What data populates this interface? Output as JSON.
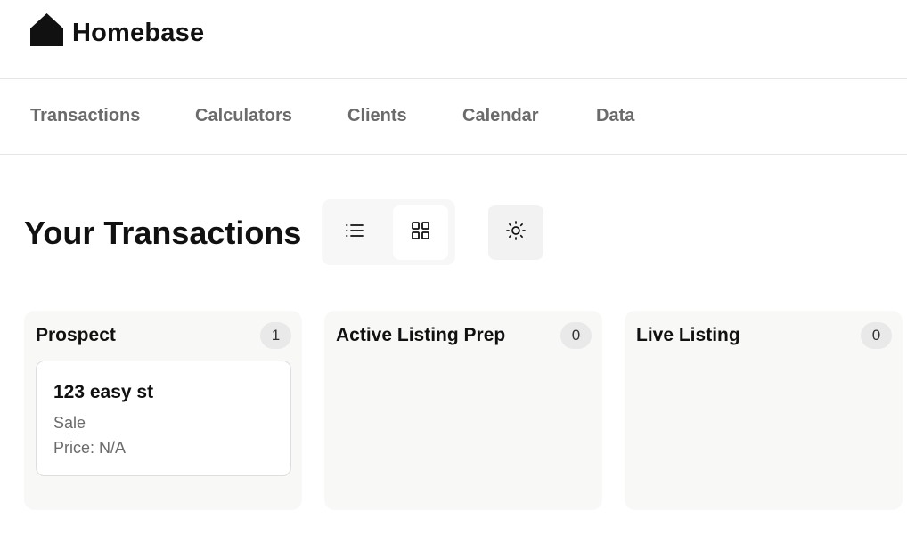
{
  "app": {
    "logo_text": "Homebase",
    "logo_icon": "house-icon"
  },
  "nav": {
    "items": [
      {
        "label": "Transactions"
      },
      {
        "label": "Calculators"
      },
      {
        "label": "Clients"
      },
      {
        "label": "Calendar"
      },
      {
        "label": "Data"
      }
    ]
  },
  "page": {
    "title": "Your Transactions",
    "view_toggle": {
      "list_icon": "list-icon",
      "grid_icon": "grid-icon",
      "selected": "grid"
    },
    "theme_icon": "sun-icon"
  },
  "columns": [
    {
      "title": "Prospect",
      "count": "1",
      "cards": [
        {
          "title": "123 easy st",
          "type": "Sale",
          "price": "Price: N/A"
        }
      ]
    },
    {
      "title": "Active Listing Prep",
      "count": "0",
      "cards": []
    },
    {
      "title": "Live Listing",
      "count": "0",
      "cards": []
    }
  ],
  "colors": {
    "text_primary": "#111111",
    "text_muted": "#6b6b6b",
    "column_bg": "#f8f8f7",
    "badge_bg": "#e9e9e9"
  }
}
